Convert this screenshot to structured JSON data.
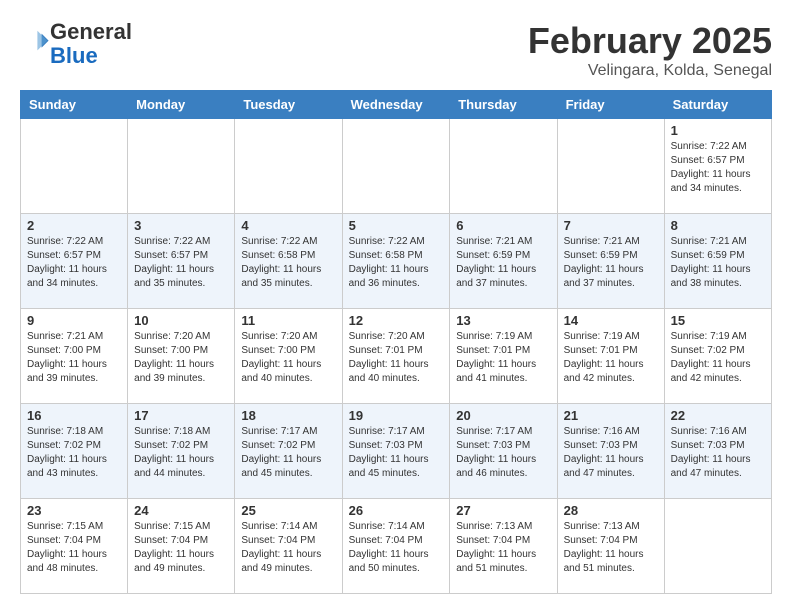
{
  "header": {
    "logo_general": "General",
    "logo_blue": "Blue",
    "month_title": "February 2025",
    "location": "Velingara, Kolda, Senegal"
  },
  "days_of_week": [
    "Sunday",
    "Monday",
    "Tuesday",
    "Wednesday",
    "Thursday",
    "Friday",
    "Saturday"
  ],
  "weeks": [
    [
      {
        "day": "",
        "info": ""
      },
      {
        "day": "",
        "info": ""
      },
      {
        "day": "",
        "info": ""
      },
      {
        "day": "",
        "info": ""
      },
      {
        "day": "",
        "info": ""
      },
      {
        "day": "",
        "info": ""
      },
      {
        "day": "1",
        "info": "Sunrise: 7:22 AM\nSunset: 6:57 PM\nDaylight: 11 hours\nand 34 minutes."
      }
    ],
    [
      {
        "day": "2",
        "info": "Sunrise: 7:22 AM\nSunset: 6:57 PM\nDaylight: 11 hours\nand 34 minutes."
      },
      {
        "day": "3",
        "info": "Sunrise: 7:22 AM\nSunset: 6:57 PM\nDaylight: 11 hours\nand 35 minutes."
      },
      {
        "day": "4",
        "info": "Sunrise: 7:22 AM\nSunset: 6:58 PM\nDaylight: 11 hours\nand 35 minutes."
      },
      {
        "day": "5",
        "info": "Sunrise: 7:22 AM\nSunset: 6:58 PM\nDaylight: 11 hours\nand 36 minutes."
      },
      {
        "day": "6",
        "info": "Sunrise: 7:21 AM\nSunset: 6:59 PM\nDaylight: 11 hours\nand 37 minutes."
      },
      {
        "day": "7",
        "info": "Sunrise: 7:21 AM\nSunset: 6:59 PM\nDaylight: 11 hours\nand 37 minutes."
      },
      {
        "day": "8",
        "info": "Sunrise: 7:21 AM\nSunset: 6:59 PM\nDaylight: 11 hours\nand 38 minutes."
      }
    ],
    [
      {
        "day": "9",
        "info": "Sunrise: 7:21 AM\nSunset: 7:00 PM\nDaylight: 11 hours\nand 39 minutes."
      },
      {
        "day": "10",
        "info": "Sunrise: 7:20 AM\nSunset: 7:00 PM\nDaylight: 11 hours\nand 39 minutes."
      },
      {
        "day": "11",
        "info": "Sunrise: 7:20 AM\nSunset: 7:00 PM\nDaylight: 11 hours\nand 40 minutes."
      },
      {
        "day": "12",
        "info": "Sunrise: 7:20 AM\nSunset: 7:01 PM\nDaylight: 11 hours\nand 40 minutes."
      },
      {
        "day": "13",
        "info": "Sunrise: 7:19 AM\nSunset: 7:01 PM\nDaylight: 11 hours\nand 41 minutes."
      },
      {
        "day": "14",
        "info": "Sunrise: 7:19 AM\nSunset: 7:01 PM\nDaylight: 11 hours\nand 42 minutes."
      },
      {
        "day": "15",
        "info": "Sunrise: 7:19 AM\nSunset: 7:02 PM\nDaylight: 11 hours\nand 42 minutes."
      }
    ],
    [
      {
        "day": "16",
        "info": "Sunrise: 7:18 AM\nSunset: 7:02 PM\nDaylight: 11 hours\nand 43 minutes."
      },
      {
        "day": "17",
        "info": "Sunrise: 7:18 AM\nSunset: 7:02 PM\nDaylight: 11 hours\nand 44 minutes."
      },
      {
        "day": "18",
        "info": "Sunrise: 7:17 AM\nSunset: 7:02 PM\nDaylight: 11 hours\nand 45 minutes."
      },
      {
        "day": "19",
        "info": "Sunrise: 7:17 AM\nSunset: 7:03 PM\nDaylight: 11 hours\nand 45 minutes."
      },
      {
        "day": "20",
        "info": "Sunrise: 7:17 AM\nSunset: 7:03 PM\nDaylight: 11 hours\nand 46 minutes."
      },
      {
        "day": "21",
        "info": "Sunrise: 7:16 AM\nSunset: 7:03 PM\nDaylight: 11 hours\nand 47 minutes."
      },
      {
        "day": "22",
        "info": "Sunrise: 7:16 AM\nSunset: 7:03 PM\nDaylight: 11 hours\nand 47 minutes."
      }
    ],
    [
      {
        "day": "23",
        "info": "Sunrise: 7:15 AM\nSunset: 7:04 PM\nDaylight: 11 hours\nand 48 minutes."
      },
      {
        "day": "24",
        "info": "Sunrise: 7:15 AM\nSunset: 7:04 PM\nDaylight: 11 hours\nand 49 minutes."
      },
      {
        "day": "25",
        "info": "Sunrise: 7:14 AM\nSunset: 7:04 PM\nDaylight: 11 hours\nand 49 minutes."
      },
      {
        "day": "26",
        "info": "Sunrise: 7:14 AM\nSunset: 7:04 PM\nDaylight: 11 hours\nand 50 minutes."
      },
      {
        "day": "27",
        "info": "Sunrise: 7:13 AM\nSunset: 7:04 PM\nDaylight: 11 hours\nand 51 minutes."
      },
      {
        "day": "28",
        "info": "Sunrise: 7:13 AM\nSunset: 7:04 PM\nDaylight: 11 hours\nand 51 minutes."
      },
      {
        "day": "",
        "info": ""
      }
    ]
  ]
}
